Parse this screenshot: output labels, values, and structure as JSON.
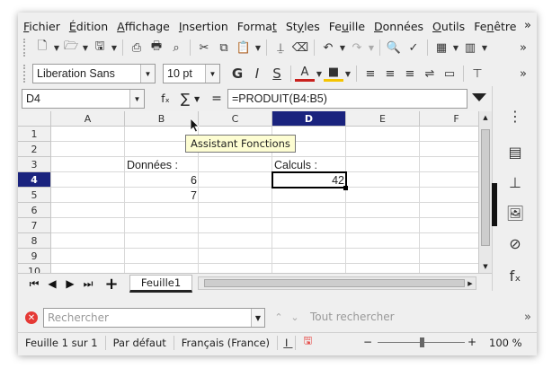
{
  "menu": [
    {
      "pre": "",
      "key": "F",
      "post": "ichier"
    },
    {
      "pre": "",
      "key": "É",
      "post": "dition"
    },
    {
      "pre": "",
      "key": "A",
      "post": "ffichage"
    },
    {
      "pre": "",
      "key": "I",
      "post": "nsertion"
    },
    {
      "pre": "Forma",
      "key": "t",
      "post": ""
    },
    {
      "pre": "St",
      "key": "y",
      "post": "les"
    },
    {
      "pre": "Fe",
      "key": "u",
      "post": "ille"
    },
    {
      "pre": "",
      "key": "D",
      "post": "onnées"
    },
    {
      "pre": "",
      "key": "O",
      "post": "utils"
    },
    {
      "pre": "Fe",
      "key": "n",
      "post": "être"
    }
  ],
  "format_toolbar": {
    "font_name": "Liberation Sans",
    "font_size": "10 pt",
    "bold": "G",
    "italic": "I",
    "underline": "S"
  },
  "formula_bar": {
    "name_box": "D4",
    "formula": "=PRODUIT(B4:B5)",
    "fx_label": "fₓ",
    "sum_label": "∑",
    "equals_label": "="
  },
  "tooltip": "Assistant Fonctions",
  "columns": [
    "A",
    "B",
    "C",
    "D",
    "E",
    "F"
  ],
  "selected_column": "D",
  "rows": [
    "1",
    "2",
    "3",
    "4",
    "5",
    "6",
    "7",
    "8",
    "9",
    "10"
  ],
  "selected_row": "4",
  "cells": {
    "b3": "Données :",
    "b4": "6",
    "b5": "7",
    "d3": "Calculs :",
    "d4": "42"
  },
  "sheet_tab": "Feuille1",
  "find": {
    "placeholder": "Rechercher",
    "find_all": "Tout rechercher"
  },
  "status": {
    "sheet": "Feuille 1 sur 1",
    "style": "Par défaut",
    "language": "Français (France)",
    "zoom": "100 %"
  },
  "colors": {
    "selection_header": "#1a237e",
    "tooltip_bg": "#fdfdd2",
    "close_red": "#e53935"
  }
}
